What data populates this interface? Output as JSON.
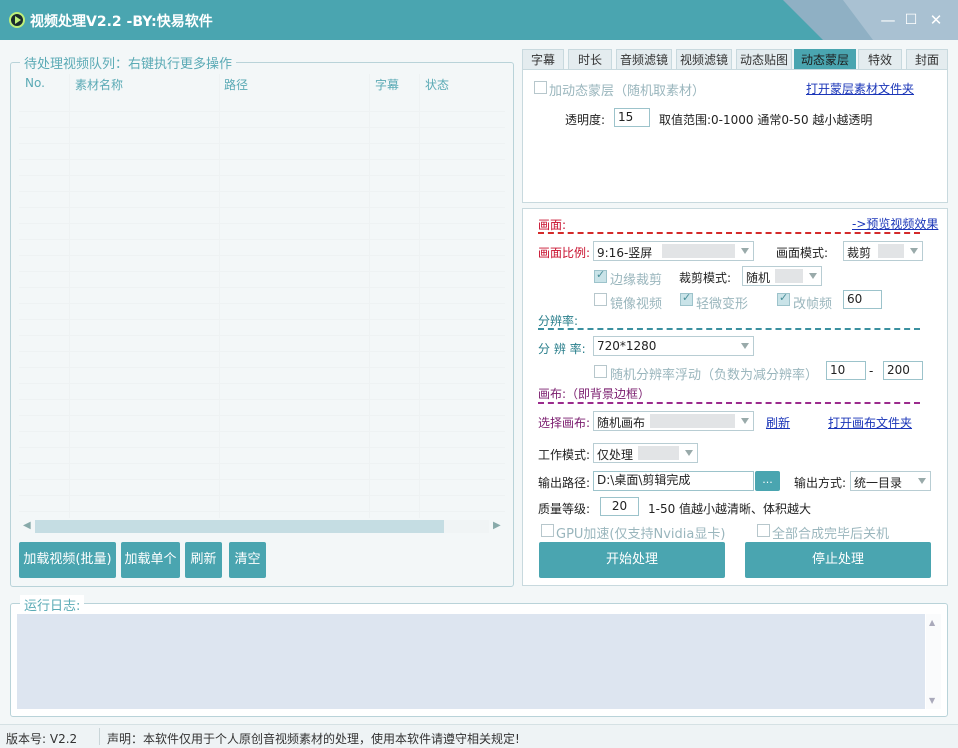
{
  "window": {
    "title": "视频处理V2.2 -BY:快易软件",
    "minimize": "—",
    "maximize": "☐",
    "close": "✕"
  },
  "queue": {
    "title": "待处理视频队列：右键执行更多操作",
    "columns": [
      "No.",
      "素材名称",
      "路径",
      "字幕",
      "状态"
    ],
    "buttons": {
      "load_batch": "加载视频(批量)",
      "load_single": "加载单个",
      "refresh": "刷新",
      "clear": "清空"
    }
  },
  "tabs": [
    "字幕",
    "时长",
    "音频滤镜",
    "视频滤镜",
    "动态贴图",
    "动态蒙层",
    "特效",
    "封面"
  ],
  "active_tab": "动态蒙层",
  "mask": {
    "enable_label": "加动态蒙层（随机取素材）",
    "open_folder": "打开蒙层素材文件夹",
    "opacity_label": "透明度:",
    "opacity_value": "15",
    "opacity_hint": "取值范围:0-1000 通常0-50 越小越透明"
  },
  "picture": {
    "section_label": "画面:",
    "preview_link": "->预览视频效果",
    "ratio_label": "画面比例:",
    "ratio_value": "9:16-竖屏",
    "mode_label": "画面模式:",
    "mode_value": "裁剪",
    "edge_crop": "边缘裁剪",
    "crop_mode_label": "裁剪模式:",
    "crop_mode_value": "随机",
    "mirror": "镜像视频",
    "slight_deform": "轻微变形",
    "change_fps": "改帧频",
    "fps_value": "60"
  },
  "resolution": {
    "section_label": "分辨率:",
    "label": "分 辨 率:",
    "value": "720*1280",
    "random_float": "随机分辨率浮动（负数为减分辨率）",
    "min": "10",
    "dash": "-",
    "max": "200"
  },
  "canvas": {
    "section_label": "画布:（即背景边框）",
    "select_label": "选择画布:",
    "select_value": "随机画布",
    "refresh": "刷新",
    "open_folder": "打开画布文件夹"
  },
  "output": {
    "work_mode_label": "工作模式:",
    "work_mode_value": "仅处理",
    "path_label": "输出路径:",
    "path_value": "D:\\桌面\\剪辑完成",
    "browse": "...",
    "method_label": "输出方式:",
    "method_value": "统一目录",
    "quality_label": "质量等级:",
    "quality_value": "20",
    "quality_hint": "1-50 值越小越清晰、体积越大",
    "gpu": "GPU加速(仅支持Nvidia显卡)",
    "shutdown": "全部合成完毕后关机",
    "start": "开始处理",
    "stop": "停止处理"
  },
  "log": {
    "title": "运行日志:"
  },
  "status": {
    "version": "版本号: V2.2",
    "notice": "声明：本软件仅用于个人原创音视频素材的处理，使用本软件请遵守相关规定!"
  }
}
